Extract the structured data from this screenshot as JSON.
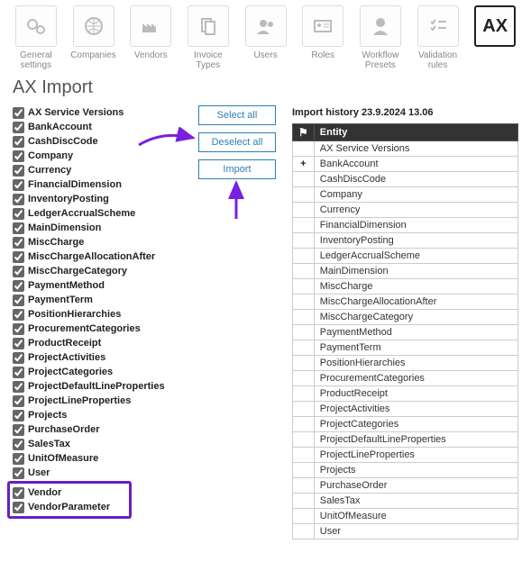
{
  "nav": {
    "items": [
      {
        "label": "General settings",
        "icon": "gears"
      },
      {
        "label": "Companies",
        "icon": "globe"
      },
      {
        "label": "Vendors",
        "icon": "factory"
      },
      {
        "label": "Invoice Types",
        "icon": "docs"
      },
      {
        "label": "Users",
        "icon": "users"
      },
      {
        "label": "Roles",
        "icon": "idcard"
      },
      {
        "label": "Workflow Presets",
        "icon": "person"
      },
      {
        "label": "Validation rules",
        "icon": "checklist"
      },
      {
        "label": "AX",
        "icon": "ax",
        "active": true
      }
    ]
  },
  "page": {
    "title": "AX Import"
  },
  "entities": [
    "AX Service Versions",
    "BankAccount",
    "CashDiscCode",
    "Company",
    "Currency",
    "FinancialDimension",
    "InventoryPosting",
    "LedgerAccrualScheme",
    "MainDimension",
    "MiscCharge",
    "MiscChargeAllocationAfter",
    "MiscChargeCategory",
    "PaymentMethod",
    "PaymentTerm",
    "PositionHierarchies",
    "ProcurementCategories",
    "ProductReceipt",
    "ProjectActivities",
    "ProjectCategories",
    "ProjectDefaultLineProperties",
    "ProjectLineProperties",
    "Projects",
    "PurchaseOrder",
    "SalesTax",
    "UnitOfMeasure",
    "User",
    "Vendor",
    "VendorParameter"
  ],
  "buttons": {
    "select_all": "Select all",
    "deselect_all": "Deselect all",
    "import": "Import"
  },
  "history": {
    "title": "Import history 23.9.2024 13.06",
    "header": {
      "flag": "⚑",
      "entity": "Entity"
    },
    "rows": [
      {
        "plus": false,
        "name": "AX Service Versions"
      },
      {
        "plus": true,
        "name": "BankAccount"
      },
      {
        "plus": false,
        "name": "CashDiscCode"
      },
      {
        "plus": false,
        "name": "Company"
      },
      {
        "plus": false,
        "name": "Currency"
      },
      {
        "plus": false,
        "name": "FinancialDimension"
      },
      {
        "plus": false,
        "name": "InventoryPosting"
      },
      {
        "plus": false,
        "name": "LedgerAccrualScheme"
      },
      {
        "plus": false,
        "name": "MainDimension"
      },
      {
        "plus": false,
        "name": "MiscCharge"
      },
      {
        "plus": false,
        "name": "MiscChargeAllocationAfter"
      },
      {
        "plus": false,
        "name": "MiscChargeCategory"
      },
      {
        "plus": false,
        "name": "PaymentMethod"
      },
      {
        "plus": false,
        "name": "PaymentTerm"
      },
      {
        "plus": false,
        "name": "PositionHierarchies"
      },
      {
        "plus": false,
        "name": "ProcurementCategories"
      },
      {
        "plus": false,
        "name": "ProductReceipt"
      },
      {
        "plus": false,
        "name": "ProjectActivities"
      },
      {
        "plus": false,
        "name": "ProjectCategories"
      },
      {
        "plus": false,
        "name": "ProjectDefaultLineProperties"
      },
      {
        "plus": false,
        "name": "ProjectLineProperties"
      },
      {
        "plus": false,
        "name": "Projects"
      },
      {
        "plus": false,
        "name": "PurchaseOrder"
      },
      {
        "plus": false,
        "name": "SalesTax"
      },
      {
        "plus": false,
        "name": "UnitOfMeasure"
      },
      {
        "plus": false,
        "name": "User"
      }
    ]
  }
}
